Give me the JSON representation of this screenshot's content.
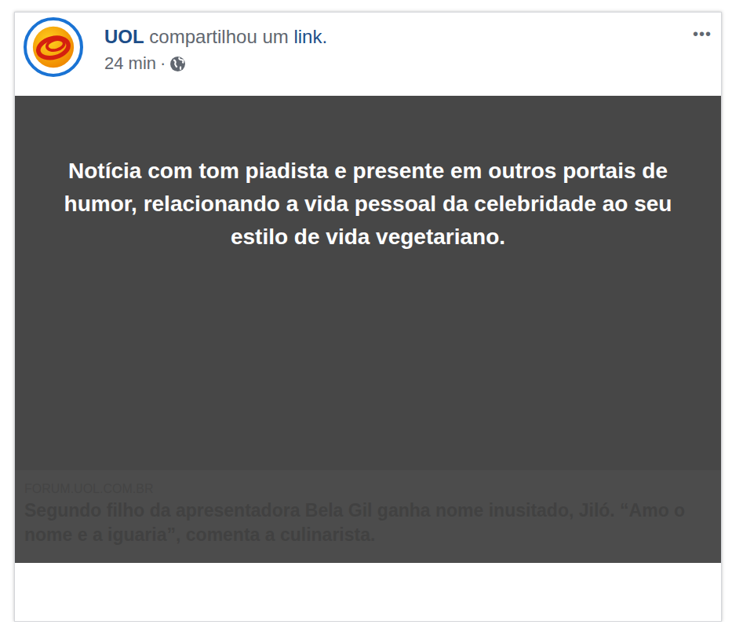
{
  "post": {
    "author": "UOL",
    "action": "compartilhou um",
    "action_link": "link.",
    "time": "24 min",
    "separator": "·",
    "menu": "•••"
  },
  "link_preview": {
    "domain": "FORUM.UOL.COM.BR",
    "title": "Segundo filho da apresentadora Bela Gil ganha nome inusitado, Jiló. “Amo o nome e a iguaria”, comenta a culinarista."
  },
  "overlay": {
    "text": "Notícia com tom piadista e presente em outros portais de humor, relacionando a vida pessoal da celebridade ao seu estilo de vida vegetariano."
  }
}
